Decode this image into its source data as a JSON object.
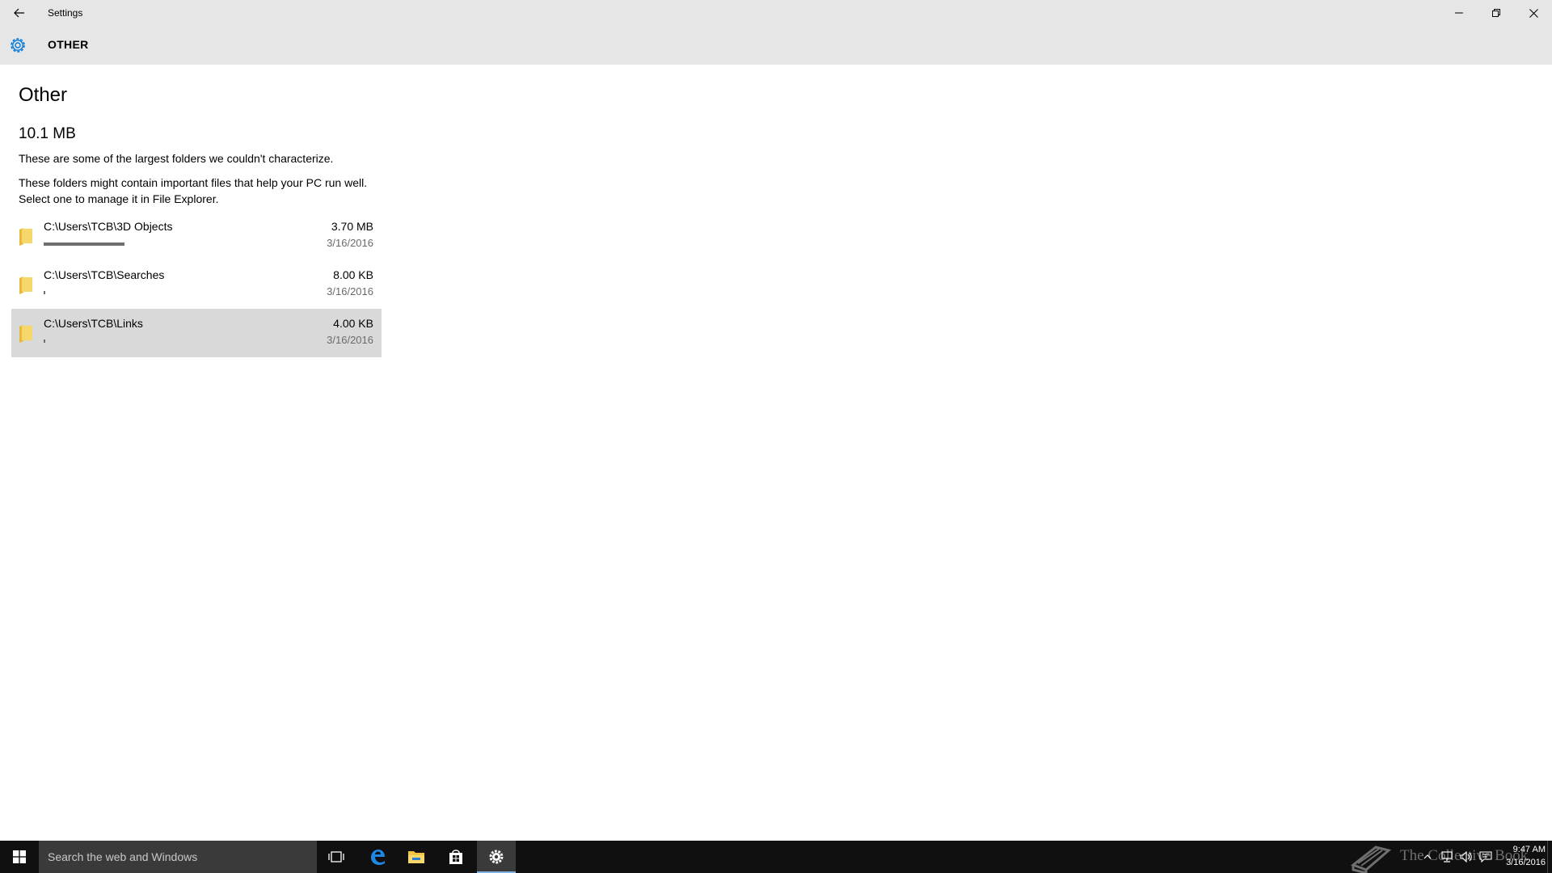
{
  "window": {
    "title": "Settings",
    "controls": [
      "minimize",
      "maximize",
      "close"
    ]
  },
  "header": {
    "icon": "gear-icon",
    "title": "OTHER"
  },
  "page": {
    "title": "Other",
    "total_size": "10.1 MB",
    "description_1": "These are some of the largest folders we couldn't characterize.",
    "description_2": "These folders might contain important files that help your PC run well. Select one to manage it in File Explorer."
  },
  "folders": [
    {
      "path": "C:\\Users\\TCB\\3D Objects",
      "size": "3.70 MB",
      "date": "3/16/2016",
      "usage_fraction": 0.295,
      "selected": false
    },
    {
      "path": "C:\\Users\\TCB\\Searches",
      "size": "8.00 KB",
      "date": "3/16/2016",
      "usage_fraction": 0.006,
      "selected": false
    },
    {
      "path": "C:\\Users\\TCB\\Links",
      "size": "4.00 KB",
      "date": "3/16/2016",
      "usage_fraction": 0.006,
      "selected": true
    }
  ],
  "taskbar": {
    "search_placeholder": "Search the web and Windows",
    "pinned": [
      "task-view-icon",
      "edge-icon",
      "file-explorer-icon",
      "store-icon",
      "settings-icon"
    ],
    "active": "settings-icon",
    "watermark": "The Collective Book",
    "clock_time": "9:47 AM",
    "clock_date": "3/16/2016"
  },
  "colors": {
    "chrome_bg": "#e6e6e6",
    "accent": "#0078d7",
    "selected_row": "#d9d9d9",
    "usage_bar": "#6e6e6e",
    "taskbar_bg": "#101010",
    "folder_yellow": "#f2c94c"
  }
}
